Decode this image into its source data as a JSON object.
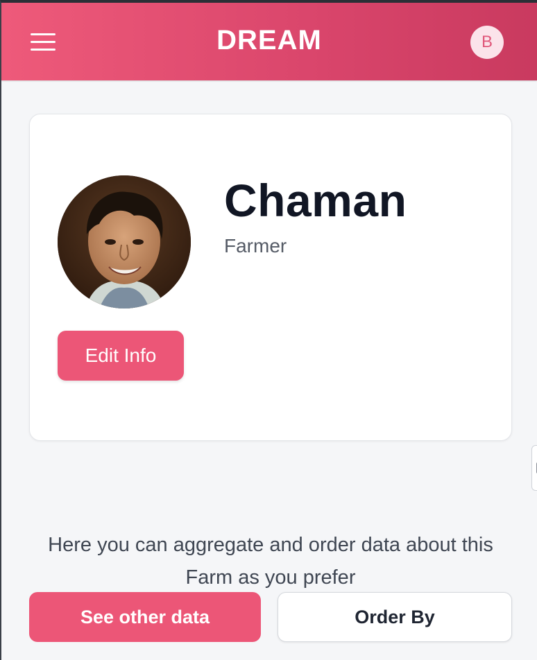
{
  "header": {
    "brand": "DREAM",
    "avatar_initial": "B",
    "menu_icon": "hamburger-menu-icon"
  },
  "profile": {
    "name": "Chaman",
    "role": "Farmer",
    "photo": "profile-photo",
    "edit_label": "Edit Info"
  },
  "data_section": {
    "description": "Here you can aggregate and order data about this Farm as you prefer",
    "see_other_label": "See other data",
    "order_by_label": "Order By"
  },
  "colors": {
    "accent": "#ec5677",
    "header_gradient_start": "#ee5a7a",
    "header_gradient_end": "#c93a5f",
    "text_dark": "#111624"
  }
}
